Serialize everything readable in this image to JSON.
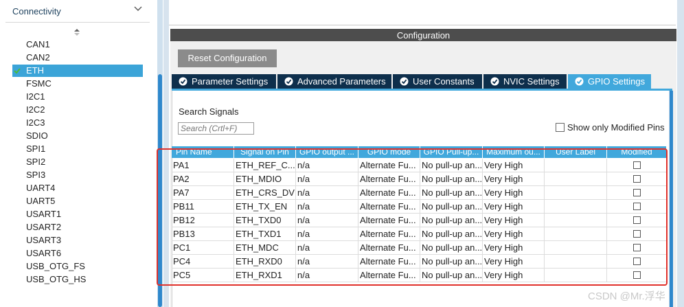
{
  "left_panel": {
    "section_title": "Connectivity",
    "items": [
      {
        "label": "CAN1",
        "selected": false
      },
      {
        "label": "CAN2",
        "selected": false
      },
      {
        "label": "ETH",
        "selected": true
      },
      {
        "label": "FSMC",
        "selected": false
      },
      {
        "label": "I2C1",
        "selected": false
      },
      {
        "label": "I2C2",
        "selected": false
      },
      {
        "label": "I2C3",
        "selected": false
      },
      {
        "label": "SDIO",
        "selected": false
      },
      {
        "label": "SPI1",
        "selected": false
      },
      {
        "label": "SPI2",
        "selected": false
      },
      {
        "label": "SPI3",
        "selected": false
      },
      {
        "label": "UART4",
        "selected": false
      },
      {
        "label": "UART5",
        "selected": false
      },
      {
        "label": "USART1",
        "selected": false
      },
      {
        "label": "USART2",
        "selected": false
      },
      {
        "label": "USART3",
        "selected": false
      },
      {
        "label": "USART6",
        "selected": false
      },
      {
        "label": "USB_OTG_FS",
        "selected": false
      },
      {
        "label": "USB_OTG_HS",
        "selected": false
      }
    ]
  },
  "config": {
    "title": "Configuration",
    "reset_label": "Reset Configuration",
    "tabs": [
      {
        "label": "Parameter Settings",
        "active": false
      },
      {
        "label": "Advanced Parameters",
        "active": false
      },
      {
        "label": "User Constants",
        "active": false
      },
      {
        "label": "NVIC Settings",
        "active": false
      },
      {
        "label": "GPIO Settings",
        "active": true
      }
    ],
    "search_label": "Search Signals",
    "search_placeholder": "Search (Crtl+F)",
    "show_modified_label": "Show only Modified Pins"
  },
  "table": {
    "headers": [
      "Pin Name",
      "Signal on Pin",
      "GPIO output ...",
      "GPIO mode",
      "GPIO Pull-up...",
      "Maximum ou...",
      "User Label",
      "Modified"
    ],
    "rows": [
      [
        "PA1",
        "ETH_REF_C...",
        "n/a",
        "Alternate Fu...",
        "No pull-up an...",
        "Very High",
        "",
        false
      ],
      [
        "PA2",
        "ETH_MDIO",
        "n/a",
        "Alternate Fu...",
        "No pull-up an...",
        "Very High",
        "",
        false
      ],
      [
        "PA7",
        "ETH_CRS_DV",
        "n/a",
        "Alternate Fu...",
        "No pull-up an...",
        "Very High",
        "",
        false
      ],
      [
        "PB11",
        "ETH_TX_EN",
        "n/a",
        "Alternate Fu...",
        "No pull-up an...",
        "Very High",
        "",
        false
      ],
      [
        "PB12",
        "ETH_TXD0",
        "n/a",
        "Alternate Fu...",
        "No pull-up an...",
        "Very High",
        "",
        false
      ],
      [
        "PB13",
        "ETH_TXD1",
        "n/a",
        "Alternate Fu...",
        "No pull-up an...",
        "Very High",
        "",
        false
      ],
      [
        "PC1",
        "ETH_MDC",
        "n/a",
        "Alternate Fu...",
        "No pull-up an...",
        "Very High",
        "",
        false
      ],
      [
        "PC4",
        "ETH_RXD0",
        "n/a",
        "Alternate Fu...",
        "No pull-up an...",
        "Very High",
        "",
        false
      ],
      [
        "PC5",
        "ETH_RXD1",
        "n/a",
        "Alternate Fu...",
        "No pull-up an...",
        "Very High",
        "",
        false
      ]
    ]
  },
  "watermark": "CSDN @Mr.浮华",
  "colors": {
    "accent": "#41a8dc",
    "tab_dark": "#0e2f4c",
    "config_bar": "#4d4d4d",
    "highlight_outline": "#e0302a"
  }
}
